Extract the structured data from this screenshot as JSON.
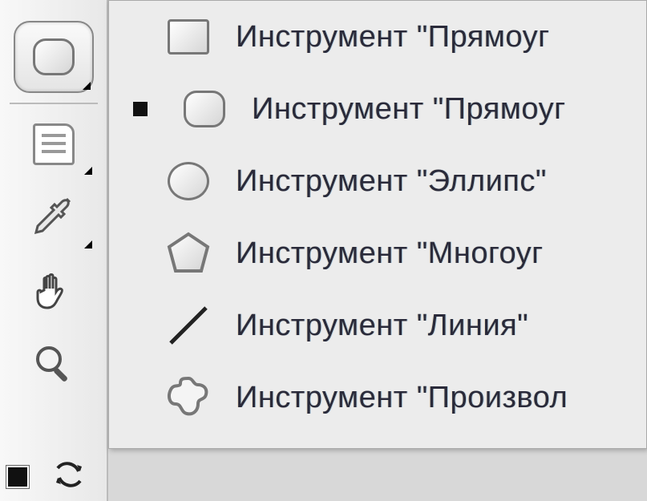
{
  "toolbar": {
    "tools": [
      {
        "name": "rounded-rectangle-tool"
      },
      {
        "name": "notes-tool"
      },
      {
        "name": "eyedropper-tool"
      },
      {
        "name": "hand-tool"
      },
      {
        "name": "zoom-tool"
      }
    ]
  },
  "flyout_menu": {
    "selected_index": 1,
    "items": [
      {
        "icon": "rectangle-icon",
        "label": "Инструмент \"Прямоуг"
      },
      {
        "icon": "rounded-rectangle-icon",
        "label": "Инструмент \"Прямоуг"
      },
      {
        "icon": "ellipse-icon",
        "label": "Инструмент \"Эллипс\""
      },
      {
        "icon": "polygon-icon",
        "label": "Инструмент \"Многоуг"
      },
      {
        "icon": "line-icon",
        "label": "Инструмент \"Линия\""
      },
      {
        "icon": "custom-shape-icon",
        "label": "Инструмент \"Произвол"
      }
    ]
  },
  "color": {
    "foreground": "#111111"
  }
}
